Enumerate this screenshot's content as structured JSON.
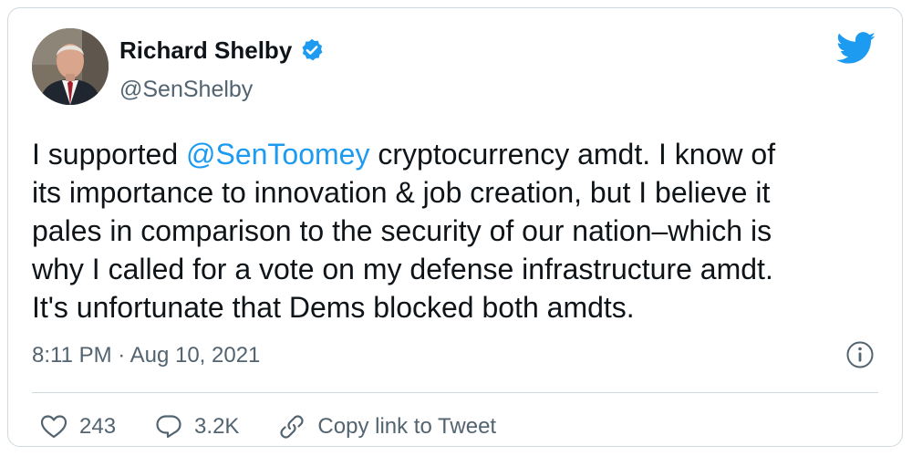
{
  "author": {
    "display_name": "Richard Shelby",
    "handle": "@SenShelby",
    "verified": true
  },
  "tweet": {
    "prefix": "I supported ",
    "mention": "@SenToomey",
    "suffix": " cryptocurrency amdt. I know of\nits importance to innovation & job creation, but I believe it\npales in comparison to the security of our nation–which is\nwhy I called for a vote on my defense infrastructure amdt.\nIt's unfortunate that Dems blocked both amdts."
  },
  "meta": {
    "timestamp": "8:11 PM · Aug 10, 2021"
  },
  "actions": {
    "likes": "243",
    "replies": "3.2K",
    "copy_link_label": "Copy link to Tweet"
  },
  "icons": {
    "brand": "twitter-bird-icon",
    "verified": "verified-badge-icon",
    "info": "info-icon",
    "like": "heart-icon",
    "reply": "reply-icon",
    "link": "link-icon"
  },
  "colors": {
    "brand_blue": "#1d9bf0",
    "text_primary": "#0f1419",
    "text_secondary": "#536471",
    "border": "#cfd9de"
  }
}
